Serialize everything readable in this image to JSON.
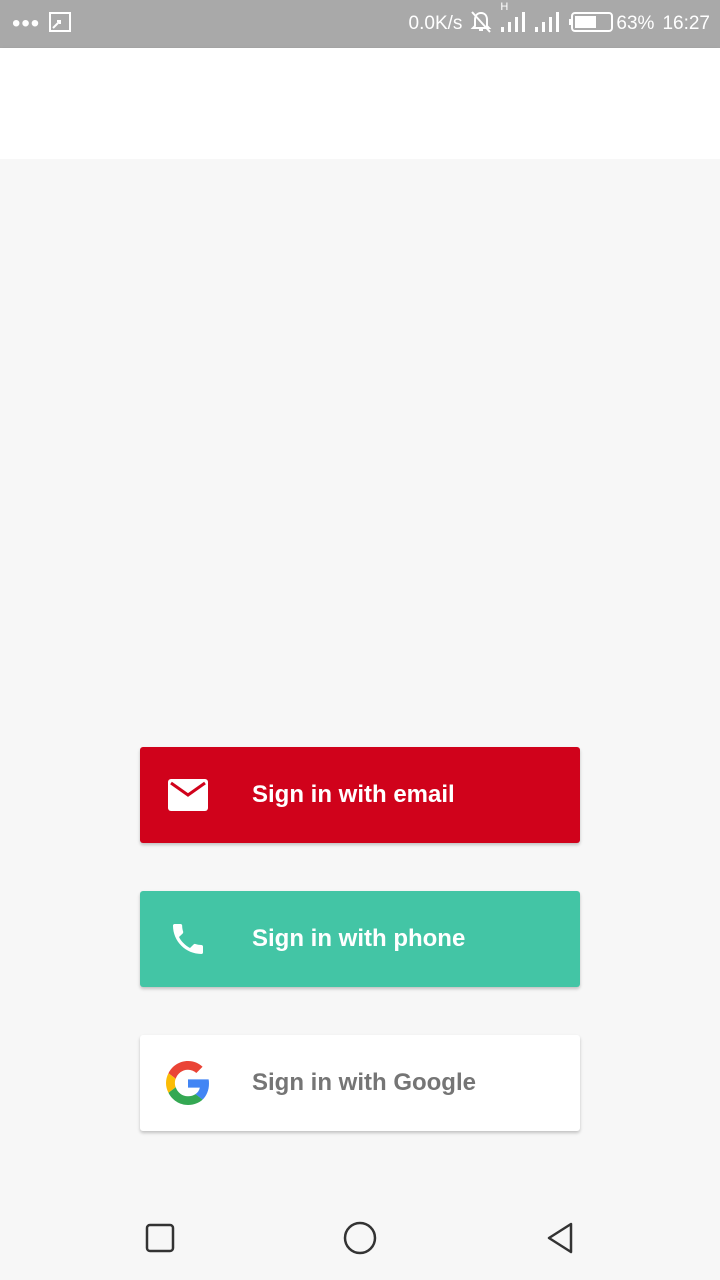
{
  "status_bar": {
    "network_speed": "0.0K/s",
    "battery_percent": "63%",
    "time": "16:27",
    "network_type": "H",
    "battery_level": 0.63,
    "icons": [
      "more-dots-icon",
      "screencast-icon",
      "notifications-off-icon",
      "signal-icon",
      "signal-icon",
      "battery-icon"
    ]
  },
  "auth": {
    "email": {
      "label": "Sign in with email",
      "icon": "mail-icon",
      "color": "#d0021b"
    },
    "phone": {
      "label": "Sign in with phone",
      "icon": "phone-icon",
      "color": "#43c5a5"
    },
    "google": {
      "label": "Sign in with Google",
      "icon": "google-icon",
      "color": "#ffffff"
    }
  },
  "nav_bar": {
    "icons": [
      "recent-apps-icon",
      "home-icon",
      "back-icon"
    ]
  },
  "colors": {
    "status_bar": "#a9a9a9",
    "background": "#f7f7f7",
    "toolbar": "#ffffff"
  }
}
